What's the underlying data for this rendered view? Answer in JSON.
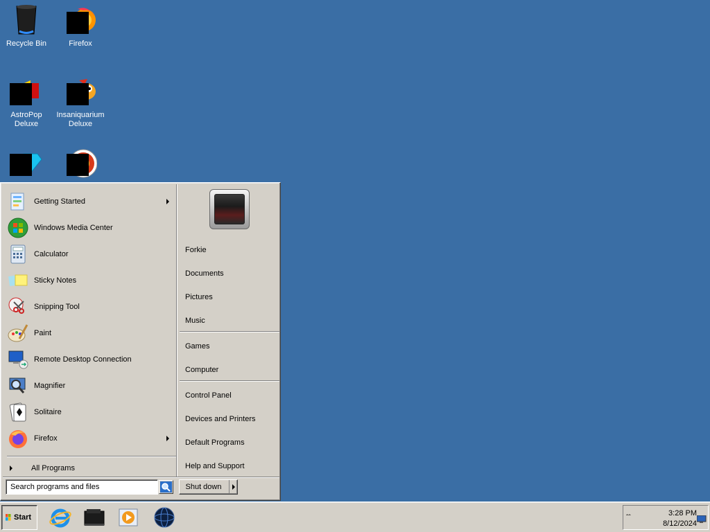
{
  "desktop": {
    "icons": [
      {
        "label": "Recycle Bin",
        "icon": "recycle-bin-icon"
      },
      {
        "label": "Firefox",
        "icon": "firefox-icon"
      },
      {
        "label": "AstroPop Deluxe",
        "icon": "astropop-icon"
      },
      {
        "label": "Insaniquarium Deluxe",
        "icon": "insaniquarium-icon"
      },
      {
        "label": "",
        "icon": "bejeweled-icon"
      },
      {
        "label": "",
        "icon": "zuma-icon"
      }
    ]
  },
  "start_menu": {
    "programs": [
      {
        "label": "Getting Started",
        "icon": "getting-started-icon",
        "submenu": true
      },
      {
        "label": "Windows Media Center",
        "icon": "windows-media-center-icon",
        "submenu": false
      },
      {
        "label": "Calculator",
        "icon": "calculator-icon",
        "submenu": false
      },
      {
        "label": "Sticky Notes",
        "icon": "sticky-notes-icon",
        "submenu": false
      },
      {
        "label": "Snipping Tool",
        "icon": "snipping-tool-icon",
        "submenu": false
      },
      {
        "label": "Paint",
        "icon": "paint-icon",
        "submenu": false
      },
      {
        "label": "Remote Desktop Connection",
        "icon": "remote-desktop-icon",
        "submenu": false
      },
      {
        "label": "Magnifier",
        "icon": "magnifier-icon",
        "submenu": false
      },
      {
        "label": "Solitaire",
        "icon": "solitaire-icon",
        "submenu": false
      },
      {
        "label": "Firefox",
        "icon": "firefox-icon",
        "submenu": true
      }
    ],
    "all_programs": "All Programs",
    "search_placeholder": "Search programs and files",
    "places": [
      {
        "label": "Forkie"
      },
      {
        "label": "Documents"
      },
      {
        "label": "Pictures"
      },
      {
        "label": "Music"
      },
      {
        "label": "Games"
      },
      {
        "label": "Computer"
      },
      {
        "label": "Control Panel"
      },
      {
        "label": "Devices and Printers"
      },
      {
        "label": "Default Programs"
      },
      {
        "label": "Help and Support"
      }
    ],
    "shutdown_label": "Shut down"
  },
  "taskbar": {
    "start_label": "Start",
    "pinned": [
      "internet-explorer-icon",
      "file-explorer-icon",
      "media-player-icon",
      "network-globe-icon"
    ],
    "clock_time": "3:28 PM",
    "clock_date": "8/12/2024"
  },
  "colors": {
    "desktop": "#3a6ea5",
    "face": "#d4d0c8"
  }
}
